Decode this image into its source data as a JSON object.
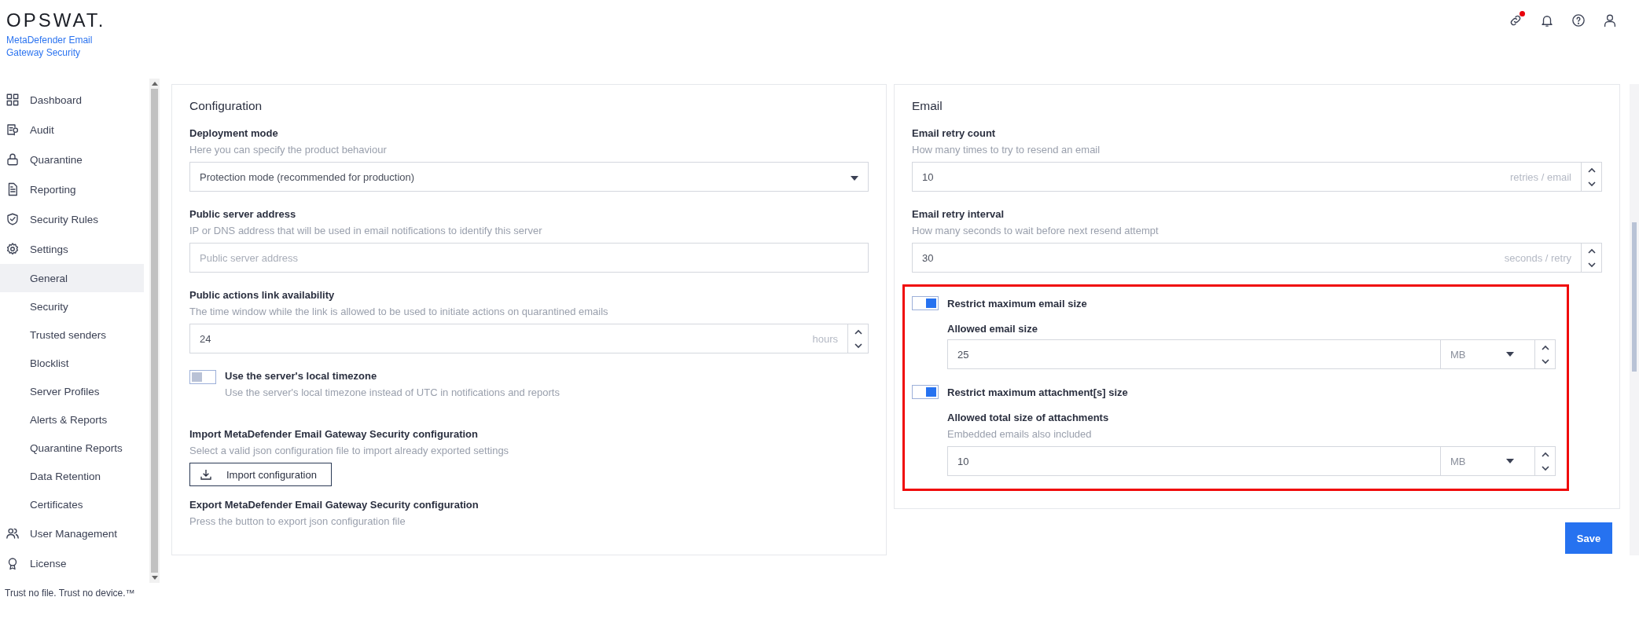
{
  "brand": {
    "logo": "OPSWAT.",
    "product": "MetaDefender Email Gateway Security"
  },
  "header_icons": [
    {
      "notification": true
    },
    {
      "notification": false
    },
    {
      "notification": false
    },
    {
      "notification": false
    }
  ],
  "sidebar": {
    "items": [
      {
        "label": "Dashboard",
        "selected": false
      },
      {
        "label": "Audit",
        "selected": false
      },
      {
        "label": "Quarantine",
        "selected": false
      },
      {
        "label": "Reporting",
        "selected": false
      },
      {
        "label": "Security Rules",
        "selected": false
      },
      {
        "label": "Settings",
        "selected": false,
        "expanded": true,
        "children": [
          {
            "label": "General",
            "selected": true
          },
          {
            "label": "Security",
            "selected": false
          },
          {
            "label": "Trusted senders",
            "selected": false
          },
          {
            "label": "Blocklist",
            "selected": false
          },
          {
            "label": "Server Profiles",
            "selected": false
          },
          {
            "label": "Alerts & Reports",
            "selected": false
          },
          {
            "label": "Quarantine Reports",
            "selected": false
          },
          {
            "label": "Data Retention",
            "selected": false
          },
          {
            "label": "Certificates",
            "selected": false
          }
        ]
      },
      {
        "label": "User Management",
        "selected": false
      },
      {
        "label": "License",
        "selected": false
      }
    ]
  },
  "footer": "Trust no file. Trust no device.™",
  "configuration": {
    "title": "Configuration",
    "fields": [
      {
        "kind": "select",
        "label": "Deployment mode",
        "hint": "Here you can specify the product behaviour",
        "value": "Protection mode (recommended for production)"
      },
      {
        "kind": "text",
        "label": "Public server address",
        "hint": "IP or DNS address that will be used in email notifications to identify this server",
        "placeholder": "Public server address"
      },
      {
        "kind": "number",
        "label": "Public actions link availability",
        "hint": "The time window while the link is allowed to be used to initiate actions on quarantined emails",
        "value": "24",
        "unit": "hours"
      },
      {
        "kind": "toggle",
        "label": "Use the server's local timezone",
        "hint": "Use the server's local timezone instead of UTC in notifications and reports",
        "on": false
      },
      {
        "kind": "button",
        "label": "Import MetaDefender Email Gateway Security configuration",
        "hint": "Select a valid json configuration file to import already exported settings",
        "button": "Import configuration"
      },
      {
        "kind": "info",
        "label": "Export MetaDefender Email Gateway Security configuration",
        "hint": "Press the button to export json configuration file"
      }
    ]
  },
  "email": {
    "title": "Email",
    "fields": [
      {
        "kind": "number",
        "label": "Email retry count",
        "hint": "How many times to try to resend an email",
        "value": "10",
        "unit": "retries / email"
      },
      {
        "kind": "number",
        "label": "Email retry interval",
        "hint": "How many seconds to wait before next resend attempt",
        "value": "30",
        "unit": "seconds / retry"
      },
      {
        "kind": "group",
        "highlighted": true,
        "items": [
          {
            "toggle": "Restrict maximum email size",
            "on": true,
            "label": "Allowed email size",
            "value": "25",
            "unit": "MB"
          },
          {
            "toggle": "Restrict maximum attachment[s] size",
            "on": true,
            "label": "Allowed total size of attachments",
            "hint": "Embedded emails also included",
            "value": "10",
            "unit": "MB"
          }
        ]
      }
    ]
  },
  "save": "Save"
}
